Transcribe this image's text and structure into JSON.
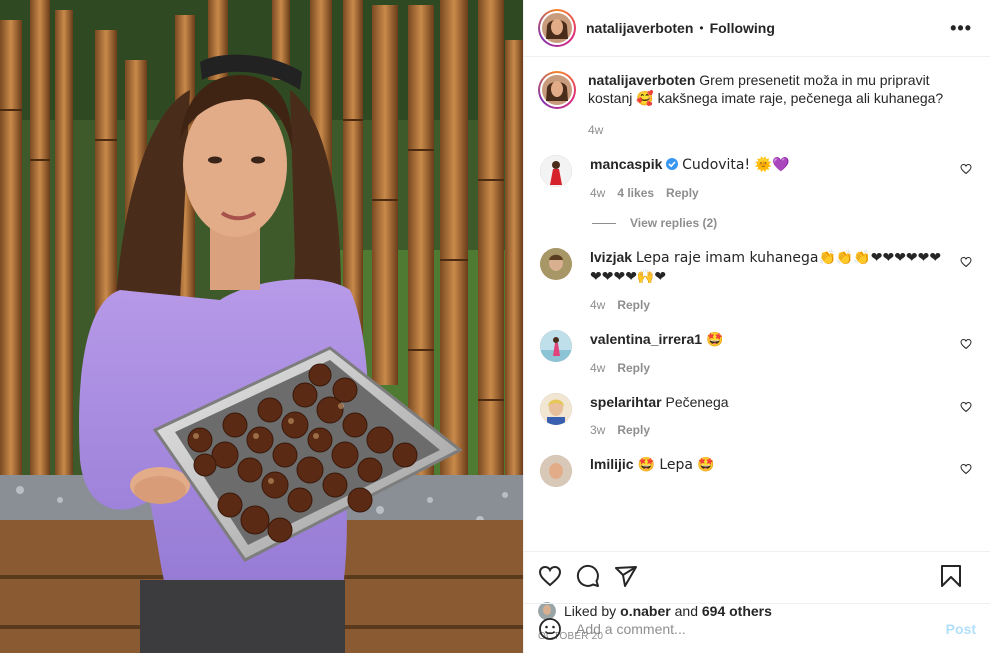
{
  "header": {
    "username": "natalijaverboten",
    "separator": "•",
    "follow_status": "Following",
    "more_label": "•••"
  },
  "caption": {
    "username": "natalijaverboten",
    "text": "Grem presenetit moža in mu pripravit kostanj 🥰 kakšnega imate raje, pečenega ali kuhanega?",
    "time": "4w"
  },
  "comments": [
    {
      "username": "mancaspik",
      "verified": true,
      "text": "Cudovita! 🌞💜",
      "time": "4w",
      "likes": "4 likes",
      "reply": "Reply",
      "view_replies": "View replies (2)"
    },
    {
      "username": "lvizjak",
      "text": "Lepa raje imam kuhanega👏👏👏❤❤❤❤❤❤❤❤❤❤🙌❤",
      "time": "4w",
      "reply": "Reply"
    },
    {
      "username": "valentina_irrera1",
      "text": "🤩",
      "time": "4w",
      "reply": "Reply"
    },
    {
      "username": "spelarihtar",
      "text": "Pečenega",
      "time": "3w",
      "reply": "Reply"
    },
    {
      "username": "lmilijic",
      "text": "🤩 Lepa 🤩",
      "time": "",
      "reply": ""
    }
  ],
  "actions": {
    "like": "heart-icon",
    "comment": "comment-icon",
    "share": "share-icon",
    "save": "bookmark-icon"
  },
  "likes": {
    "prefix": "Liked by ",
    "user": "o.naber",
    "middle": " and ",
    "others": "694 others"
  },
  "post_date": "OCTOBER 20",
  "add_comment": {
    "placeholder": "Add a comment...",
    "post_label": "Post",
    "emoji_icon": "smiley-icon"
  },
  "colors": {
    "text": "#262626",
    "secondary": "#8e8e8e",
    "post_disabled": "#b2dffc",
    "verified": "#3897f0",
    "border": "#efefef"
  }
}
